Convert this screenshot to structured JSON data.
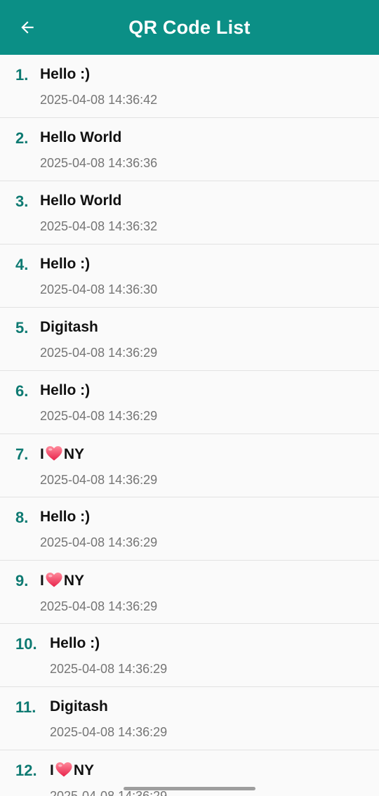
{
  "appbar": {
    "title": "QR Code List",
    "back_icon": "arrow-left-icon",
    "color": "#0b8f86"
  },
  "accent_color": "#0e7a72",
  "items": [
    {
      "number": "1.",
      "text": "Hello :)",
      "timestamp": "2025-04-08 14:36:42",
      "parts": [
        "Hello :)"
      ]
    },
    {
      "number": "2.",
      "text": "Hello World",
      "timestamp": "2025-04-08 14:36:36",
      "parts": [
        "Hello World"
      ]
    },
    {
      "number": "3.",
      "text": "Hello World",
      "timestamp": "2025-04-08 14:36:32",
      "parts": [
        "Hello World"
      ]
    },
    {
      "number": "4.",
      "text": "Hello :)",
      "timestamp": "2025-04-08 14:36:30",
      "parts": [
        "Hello :)"
      ]
    },
    {
      "number": "5.",
      "text": "Digitash",
      "timestamp": "2025-04-08 14:36:29",
      "parts": [
        "Digitash"
      ]
    },
    {
      "number": "6.",
      "text": "Hello :)",
      "timestamp": "2025-04-08 14:36:29",
      "parts": [
        "Hello :)"
      ]
    },
    {
      "number": "7.",
      "text": "I❤️NY",
      "timestamp": "2025-04-08 14:36:29",
      "parts": [
        "I",
        "NY"
      ]
    },
    {
      "number": "8.",
      "text": "Hello :)",
      "timestamp": "2025-04-08 14:36:29",
      "parts": [
        "Hello :)"
      ]
    },
    {
      "number": "9.",
      "text": "I❤️NY",
      "timestamp": "2025-04-08 14:36:29",
      "parts": [
        "I",
        "NY"
      ]
    },
    {
      "number": "10.",
      "text": "Hello :)",
      "timestamp": "2025-04-08 14:36:29",
      "parts": [
        "Hello :)"
      ]
    },
    {
      "number": "11.",
      "text": "Digitash",
      "timestamp": "2025-04-08 14:36:29",
      "parts": [
        "Digitash"
      ]
    },
    {
      "number": "12.",
      "text": "I❤️NY",
      "timestamp": "2025-04-08 14:36:29",
      "parts": [
        "I",
        "NY"
      ]
    }
  ],
  "heart_icon": "heart-emoji-icon"
}
